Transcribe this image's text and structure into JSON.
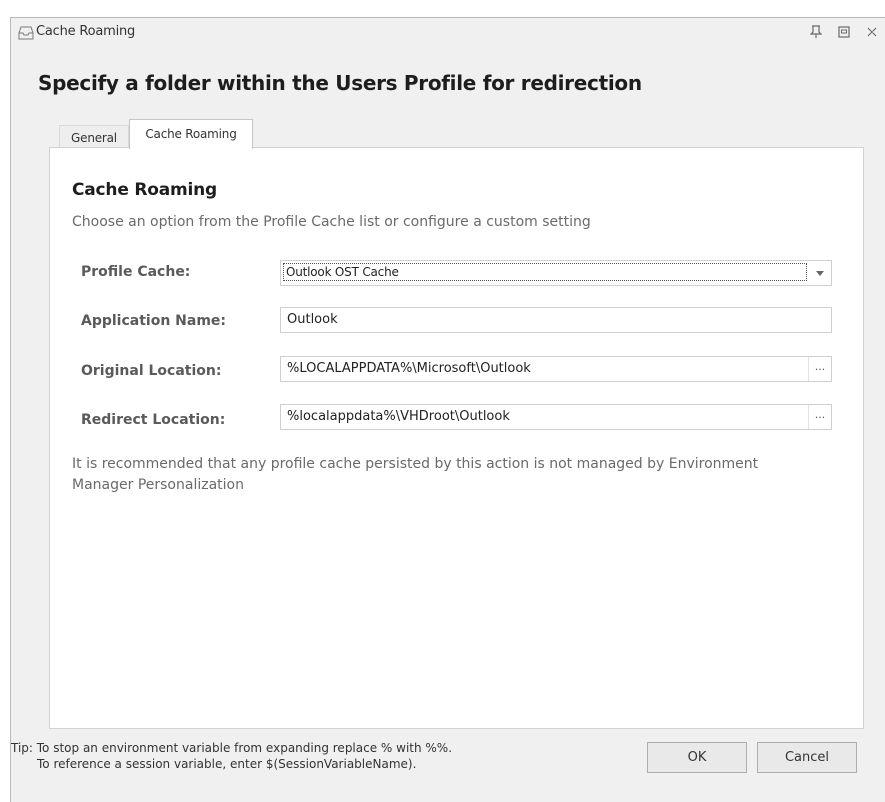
{
  "window": {
    "title": "Cache Roaming"
  },
  "heading": "Specify a folder within the Users Profile for redirection",
  "tabs": [
    {
      "label": "General"
    },
    {
      "label": "Cache Roaming",
      "selected": true
    }
  ],
  "section": {
    "title": "Cache Roaming",
    "description": "Choose an option from the Profile Cache list or configure a custom setting"
  },
  "form": {
    "profile_cache": {
      "label": "Profile Cache:",
      "value": "Outlook OST Cache"
    },
    "application_name": {
      "label": "Application Name:",
      "value": "Outlook"
    },
    "original_location": {
      "label": "Original Location:",
      "value": "%LOCALAPPDATA%\\Microsoft\\Outlook",
      "browse_label": "···"
    },
    "redirect_location": {
      "label": "Redirect Location:",
      "value": "%localappdata%\\VHDroot\\Outlook",
      "browse_label": "···"
    }
  },
  "note": "It is recommended that any profile cache persisted by this action is not managed by Environment Manager Personalization",
  "tip": {
    "line1": "Tip: To stop an environment variable from expanding replace % with %%.",
    "line2": "To reference a session variable, enter $(SessionVariableName)."
  },
  "buttons": {
    "ok": "OK",
    "cancel": "Cancel"
  },
  "icons": {
    "window": "window-icon",
    "pin": "pin-icon",
    "maximize": "maximize-icon",
    "close": "close-icon",
    "dropdown": "chevron-down-icon"
  },
  "colors": {
    "window_bg": "#f0f0f0",
    "panel_bg": "#ffffff",
    "label_text": "#5a5a5a",
    "description_text": "#6a6a6a"
  }
}
